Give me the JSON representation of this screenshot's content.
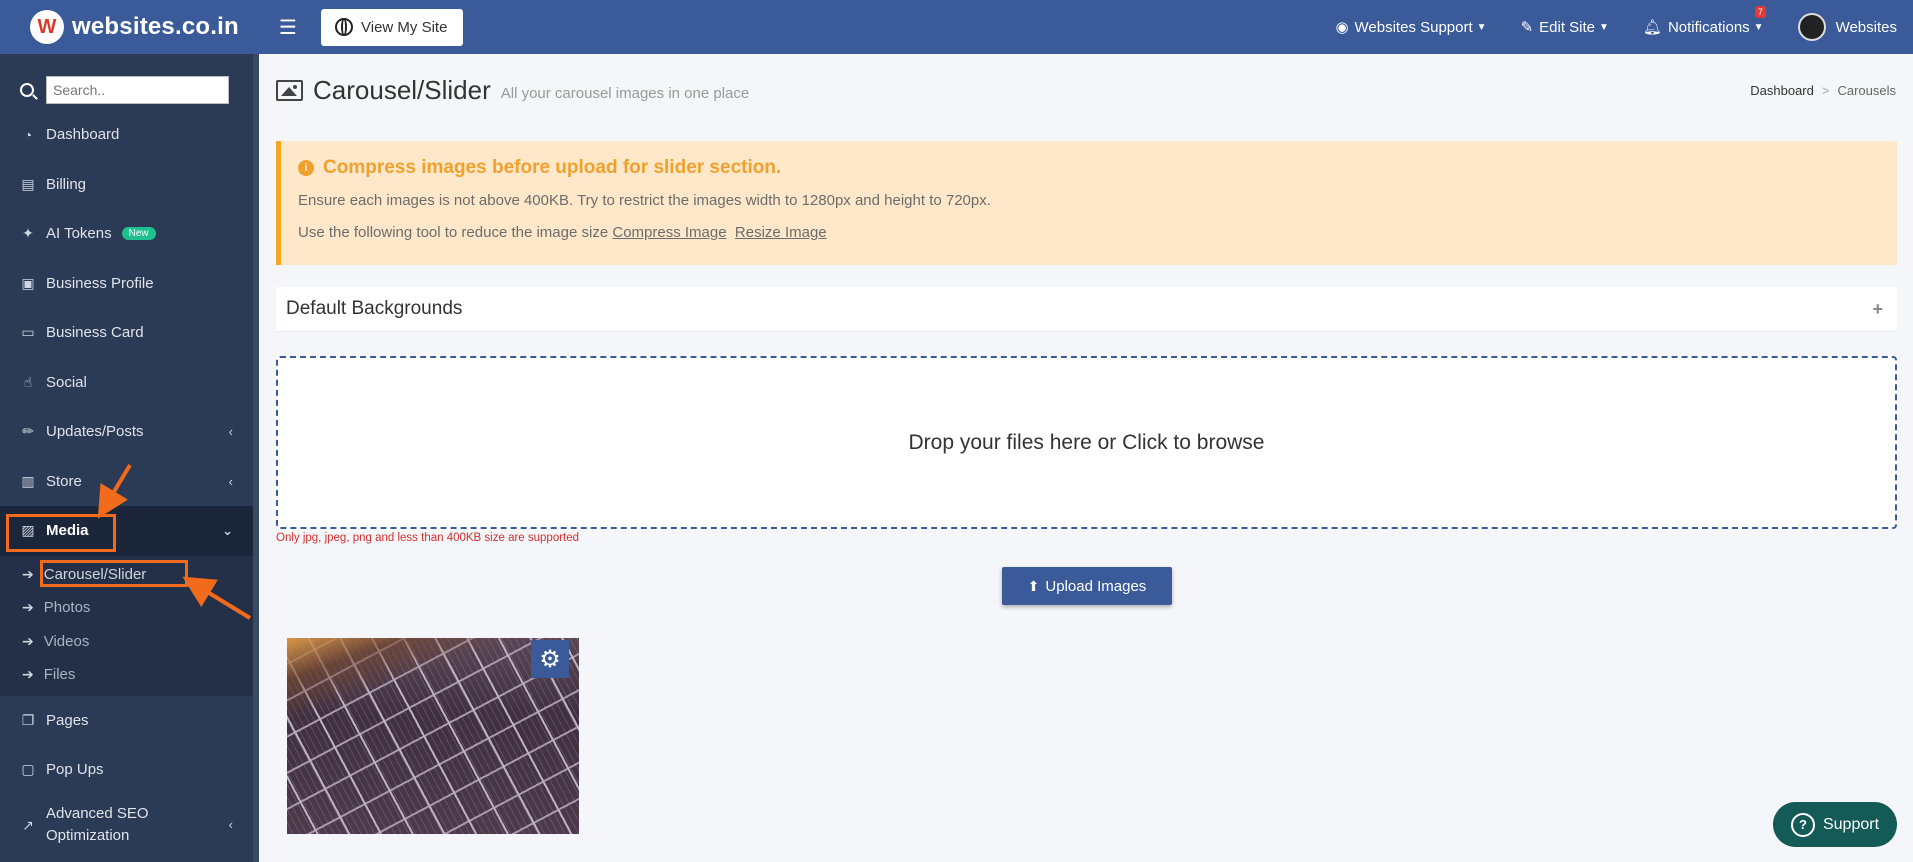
{
  "brand": {
    "logo_letter": "W",
    "name": "websites.co.in"
  },
  "topbar": {
    "view_site_label": "View My Site",
    "support_menu": "Websites Support",
    "edit_site": "Edit Site",
    "notifications": "Notifications",
    "notification_count": "7",
    "account": "Websites"
  },
  "sidebar": {
    "search_placeholder": "Search..",
    "items": [
      {
        "label": "Dashboard",
        "icon": "dashboard-icon"
      },
      {
        "label": "Billing",
        "icon": "file-icon"
      },
      {
        "label": "AI Tokens",
        "icon": "magic-wand-icon",
        "badge": "New"
      },
      {
        "label": "Business Profile",
        "icon": "briefcase-icon"
      },
      {
        "label": "Business Card",
        "icon": "id-card-icon"
      },
      {
        "label": "Social",
        "icon": "thumbs-up-icon"
      },
      {
        "label": "Updates/Posts",
        "icon": "pencil-icon"
      },
      {
        "label": "Store",
        "icon": "store-icon"
      },
      {
        "label": "Media",
        "icon": "image-icon"
      },
      {
        "label": "Pages",
        "icon": "copy-icon"
      },
      {
        "label": "Pop Ups",
        "icon": "window-icon"
      },
      {
        "label": "Advanced SEO Optimization",
        "icon": "trend-icon"
      }
    ],
    "media_sub": [
      {
        "label": "Carousel/Slider"
      },
      {
        "label": "Photos"
      },
      {
        "label": "Videos"
      },
      {
        "label": "Files"
      }
    ]
  },
  "header": {
    "title": "Carousel/Slider",
    "subtitle": "All your carousel images in one place",
    "breadcrumb": [
      "Dashboard",
      "Carousels"
    ]
  },
  "alert": {
    "title": "Compress images before upload for slider section.",
    "line1": "Ensure each images is not above 400KB. Try to restrict the images width to 1280px and height to 720px.",
    "line2_prefix": "Use the following tool to reduce the image size",
    "link_compress": "Compress Image",
    "link_resize": "Resize Image",
    "accent_color": "#f0a12d"
  },
  "accordion": {
    "title": "Default Backgrounds"
  },
  "dropzone": {
    "text": "Drop your files here or Click to browse",
    "note": "Only jpg, jpeg, png and less than 400KB size are supported"
  },
  "upload": {
    "label": "Upload Images"
  },
  "support": {
    "label": "Support"
  },
  "colors": {
    "primary": "#3a5a99",
    "sidebar": "#2b3a55",
    "annotation": "#f26a1b",
    "support": "#145a57"
  }
}
